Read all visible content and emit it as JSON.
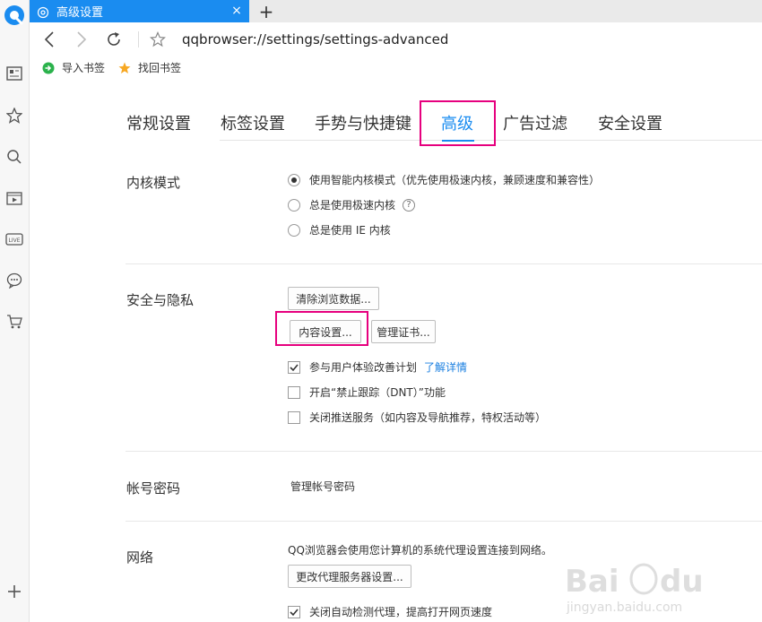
{
  "tab": {
    "title": "高级设置",
    "close": "×",
    "new_tab": "+"
  },
  "address": {
    "url": "qqbrowser://settings/settings-advanced"
  },
  "bookmarks": {
    "import": "导入书签",
    "recover": "找回书签"
  },
  "nav": {
    "general": "常规设置",
    "tabs": "标签设置",
    "gestures": "手势与快捷键",
    "advanced": "高级",
    "adblock": "广告过滤",
    "security": "安全设置"
  },
  "kernel": {
    "title": "内核模式",
    "options": [
      "使用智能内核模式（优先使用极速内核，兼顾速度和兼容性）",
      "总是使用极速内核",
      "总是使用 IE 内核"
    ],
    "selected_index": 0,
    "help": "?"
  },
  "privacy": {
    "title": "安全与隐私",
    "clear_btn": "清除浏览数据...",
    "content_btn": "内容设置...",
    "cert_btn": "管理证书...",
    "ux_plan": "参与用户体验改善计划",
    "ux_link": "了解详情",
    "dnt": "开启“禁止跟踪（DNT）”功能",
    "push": "关闭推送服务（如内容及导航推荐，特权活动等）"
  },
  "account": {
    "title": "帐号密码",
    "manage_link": "管理帐号密码"
  },
  "network": {
    "title": "网络",
    "desc": "QQ浏览器会使用您计算机的系统代理设置连接到网络。",
    "proxy_btn": "更改代理服务器设置...",
    "auto_detect": "关闭自动检测代理，提高打开网页速度"
  },
  "colors": {
    "accent": "#1a8cf0",
    "highlight": "#e6007e",
    "link": "#1a7fe0"
  }
}
